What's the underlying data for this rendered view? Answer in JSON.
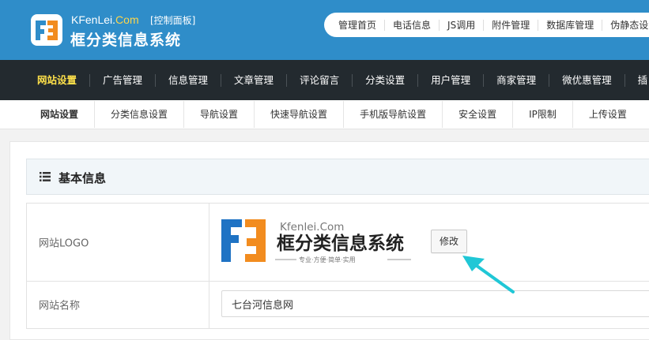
{
  "brand": {
    "site_prefix": "KFenLei.",
    "site_suffix": "Com",
    "tag": "[控制面板]",
    "title": "框分类信息系统",
    "accent": "#ffd64a",
    "header_color": "#2f8dc9"
  },
  "top_nav": [
    "管理首页",
    "电话信息",
    "JS调用",
    "附件管理",
    "数据库管理",
    "伪静态设"
  ],
  "main_nav": {
    "active_color": "#ffe14a",
    "items": [
      "网站设置",
      "广告管理",
      "信息管理",
      "文章管理",
      "评论留言",
      "分类设置",
      "用户管理",
      "商家管理",
      "微优惠管理",
      "插"
    ]
  },
  "sub_nav": [
    "网站设置",
    "分类信息设置",
    "导航设置",
    "快速导航设置",
    "手机版导航设置",
    "安全设置",
    "IP限制",
    "上传设置"
  ],
  "panel": {
    "icon": "list-icon",
    "title": "基本信息"
  },
  "logo_row": {
    "label": "网站LOGO",
    "logo_domain": "Kfenlei.Com",
    "logo_name": "框分类信息系统",
    "logo_slogan": "专业·方便·简单·实用",
    "edit_label": "修改"
  },
  "name_row": {
    "label": "网站名称",
    "value": "七台河信息网"
  },
  "annotation": {
    "arrow_color": "#20c7d6"
  }
}
